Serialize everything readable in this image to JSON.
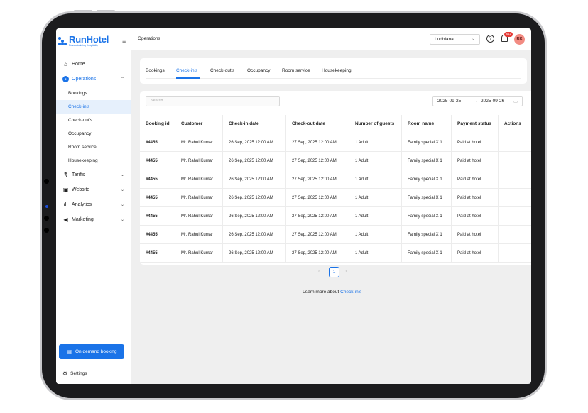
{
  "brand": {
    "name": "RunHotel",
    "tagline": "Revolutionizing Hospitality"
  },
  "colors": {
    "accent": "#1a73e8",
    "active_bg": "#e6f0fc",
    "badge": "#e53935",
    "avatar": "#f28b82"
  },
  "sidebar": {
    "items": [
      {
        "label": "Home",
        "icon": "home-icon"
      },
      {
        "label": "Operations",
        "icon": "operations-icon",
        "expanded": true
      },
      {
        "label": "Tariffs",
        "icon": "tariffs-icon"
      },
      {
        "label": "Website",
        "icon": "website-icon"
      },
      {
        "label": "Analytics",
        "icon": "analytics-icon"
      },
      {
        "label": "Marketing",
        "icon": "megaphone-icon"
      }
    ],
    "sub_items": [
      "Bookings",
      "Check-in's",
      "Check-out's",
      "Occupancy",
      "Room service",
      "Housekeeping"
    ],
    "on_demand_label": "On demand booking",
    "settings_label": "Settings"
  },
  "header": {
    "title": "Operations",
    "city": "Ludhiana",
    "notification_badge": "99+",
    "avatar_initials": "RK"
  },
  "tabs": [
    "Bookings",
    "Check-in's",
    "Check-out's",
    "Occupancy",
    "Room service",
    "Housekeeping"
  ],
  "active_tab": "Check-in's",
  "search": {
    "placeholder": "Search"
  },
  "daterange": {
    "start": "2025-09-25",
    "end": "2025-09-26"
  },
  "table": {
    "columns": [
      "Booking id",
      "Customer",
      "Check-in date",
      "Check-out date",
      "Number of guests",
      "Room name",
      "Payment status",
      "Actions"
    ],
    "rows": [
      [
        "#4455",
        "Mr. Rahul Kumar",
        "26 Sep, 2025 12:00 AM",
        "27 Sep, 2025 12:00 AM",
        "1 Adult",
        "Family special X 1",
        "Paid at hotel",
        ""
      ],
      [
        "#4455",
        "Mr. Rahul Kumar",
        "26 Sep, 2025 12:00 AM",
        "27 Sep, 2025 12:00 AM",
        "1 Adult",
        "Family special X 1",
        "Paid at hotel",
        ""
      ],
      [
        "#4455",
        "Mr. Rahul Kumar",
        "26 Sep, 2025 12:00 AM",
        "27 Sep, 2025 12:00 AM",
        "1 Adult",
        "Family special X 1",
        "Paid at hotel",
        ""
      ],
      [
        "#4455",
        "Mr. Rahul Kumar",
        "26 Sep, 2025 12:00 AM",
        "27 Sep, 2025 12:00 AM",
        "1 Adult",
        "Family special X 1",
        "Paid at hotel",
        ""
      ],
      [
        "#4455",
        "Mr. Rahul Kumar",
        "26 Sep, 2025 12:00 AM",
        "27 Sep, 2025 12:00 AM",
        "1 Adult",
        "Family special X 1",
        "Paid at hotel",
        ""
      ],
      [
        "#4455",
        "Mr. Rahul Kumar",
        "26 Sep, 2025 12:00 AM",
        "27 Sep, 2025 12:00 AM",
        "1 Adult",
        "Family special X 1",
        "Paid at hotel",
        ""
      ],
      [
        "#4455",
        "Mr. Rahul Kumar",
        "26 Sep, 2025 12:00 AM",
        "27 Sep, 2025 12:00 AM",
        "1 Adult",
        "Family special X 1",
        "Paid at hotel",
        ""
      ]
    ]
  },
  "pagination": {
    "current_page": "1"
  },
  "footer": {
    "learn_text": "Learn more about",
    "learn_link": "Check-in's"
  }
}
